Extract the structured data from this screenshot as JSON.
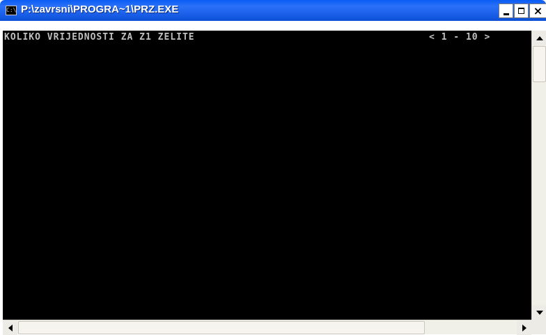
{
  "window": {
    "title": "P:\\zavrsni\\PROGRA~1\\PRZ.EXE",
    "icon": "console-icon",
    "icon_text": "C:\\",
    "controls": {
      "minimize_icon": "minimize-icon",
      "maximize_icon": "maximize-icon",
      "close_icon": "close-icon",
      "close_glyph": "×"
    }
  },
  "console": {
    "prompt": "KOLIKO VRIJEDNOSTI ZA Z1 ZELITE",
    "range_hint": "< 1 - 10 >",
    "background": "#000000",
    "text_color": "#c0c0c0"
  },
  "colors": {
    "titlebar": "#0a5cf5",
    "title_text": "#ffffff",
    "scrollbar": "#f0efe8"
  }
}
